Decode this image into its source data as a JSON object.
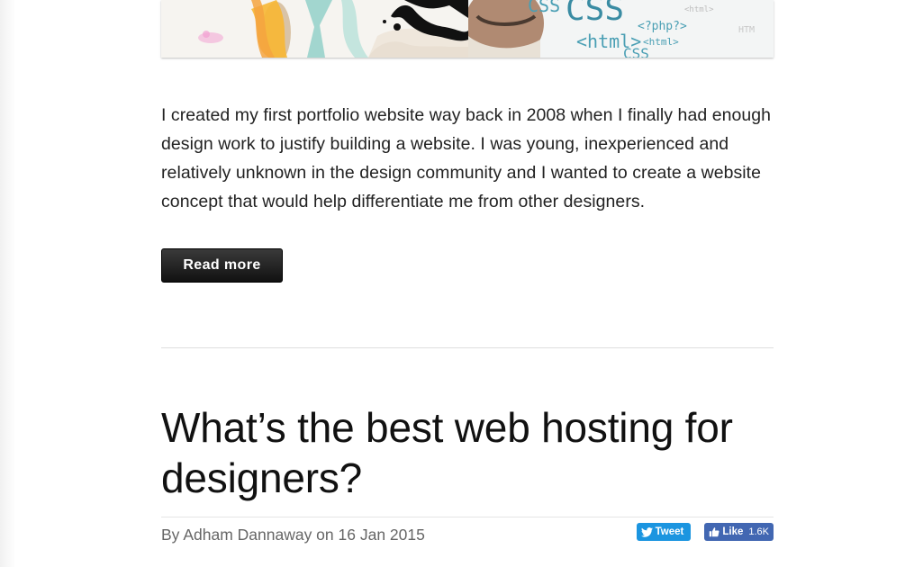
{
  "hero": {
    "code_words": [
      "CSS",
      "CSS",
      "<html>",
      "<?php?>",
      "<html>",
      "CSS",
      "<html>",
      "HTM"
    ]
  },
  "article_previous": {
    "excerpt": "I created my first portfolio website way back in 2008 when I finally had enough design work to justify building a website. I was young, inexperienced and relatively unknown in the design community and I wanted to create a website concept that would help differentiate me from other designers.",
    "read_more_label": "Read more"
  },
  "article_next": {
    "title": "What’s the best web hosting for designers?",
    "byline": "By Adham Dannaway on 16 Jan 2015",
    "tweet_label": "Tweet",
    "like_label": "Like",
    "like_count": "1.6K"
  },
  "colors": {
    "tweet": "#1b95e0",
    "facebook": "#4267b2",
    "button_dark": "#1a1a1a"
  },
  "icons": {
    "tweet": "twitter-bird-icon",
    "like": "thumbs-up-icon"
  }
}
